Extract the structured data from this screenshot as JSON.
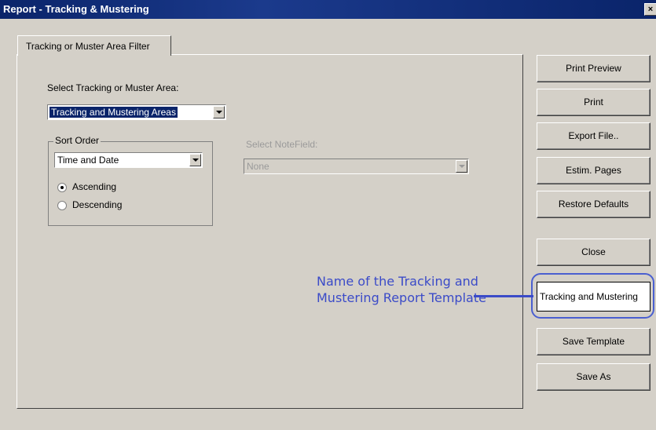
{
  "window": {
    "title": "Report  - Tracking & Mustering",
    "close_glyph": "×"
  },
  "tabs": [
    {
      "label": "Tracking or Muster Area Filter",
      "active": true
    }
  ],
  "filter": {
    "area_label": "Select Tracking or Muster Area:",
    "area_value": "Tracking and Mustering Areas",
    "sort_group_title": "Sort Order",
    "sort_value": "Time and Date",
    "ascending_label": "Ascending",
    "descending_label": "Descending",
    "sort_direction": "Ascending",
    "notefield_label": "Select NoteField:",
    "notefield_value": "None"
  },
  "buttons": {
    "print_preview": "Print Preview",
    "print": "Print",
    "export_file": "Export File..",
    "estim_pages": "Estim. Pages",
    "restore_defaults": "Restore Defaults",
    "close": "Close",
    "save_template": "Save Template",
    "save_as": "Save As"
  },
  "template": {
    "name_value": "Tracking and Mustering"
  },
  "annotation": {
    "text": "Name of the Tracking and Mustering Report Template",
    "color": "#3b4bc8"
  }
}
